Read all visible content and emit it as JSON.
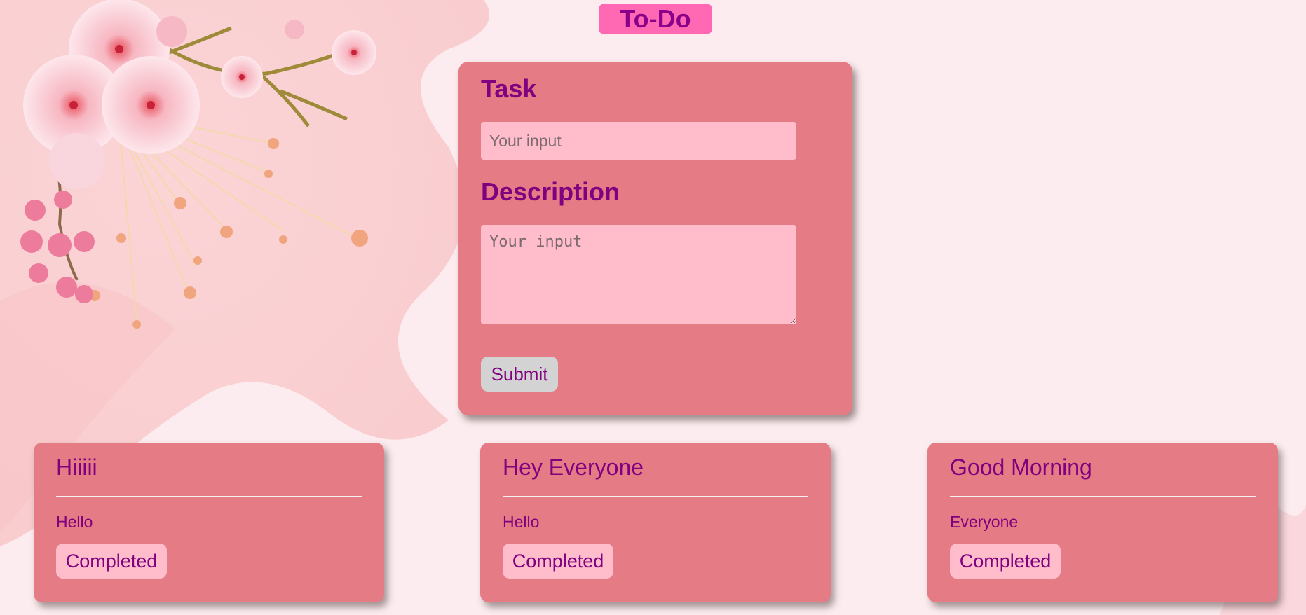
{
  "header": {
    "title": "To-Do"
  },
  "form": {
    "task_label": "Task",
    "task_placeholder": "Your input",
    "description_label": "Description",
    "description_placeholder": "Your input",
    "submit_label": "Submit"
  },
  "tasks": [
    {
      "title": "Hiiiii",
      "description": "Hello",
      "button_label": "Completed"
    },
    {
      "title": "Hey Everyone",
      "description": "Hello",
      "button_label": "Completed"
    },
    {
      "title": "Good Morning",
      "description": "Everyone",
      "button_label": "Completed"
    }
  ],
  "theme": {
    "background": "#fcecef",
    "card": "#e57c85",
    "accent": "#ff69b4",
    "text": "#800080",
    "input": "#ffbccb",
    "submit_button": "#d3d3d3"
  }
}
